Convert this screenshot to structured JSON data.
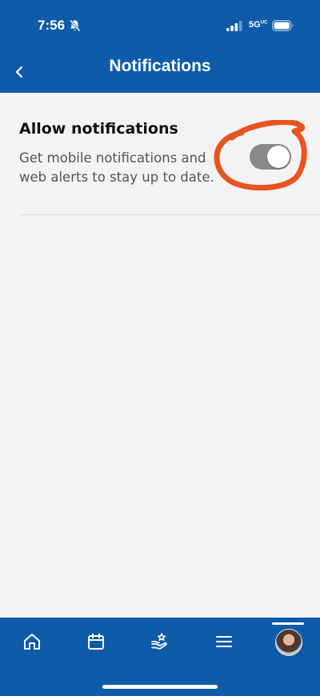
{
  "status_bar": {
    "time": "7:56",
    "network": "5G",
    "network_suffix": "UC"
  },
  "header": {
    "title": "Notifications"
  },
  "setting": {
    "title": "Allow notifications",
    "description": "Get mobile notifications and web alerts to stay up to date.",
    "enabled": true
  },
  "tab_bar": {
    "items": [
      "home-icon",
      "calendar-icon",
      "care-hand-star-icon",
      "menu-icon",
      "avatar"
    ],
    "selected": "avatar"
  },
  "colors": {
    "brand": "#0e5ba9",
    "toggle": "#8a8a8a",
    "annotation": "#e8541f"
  }
}
